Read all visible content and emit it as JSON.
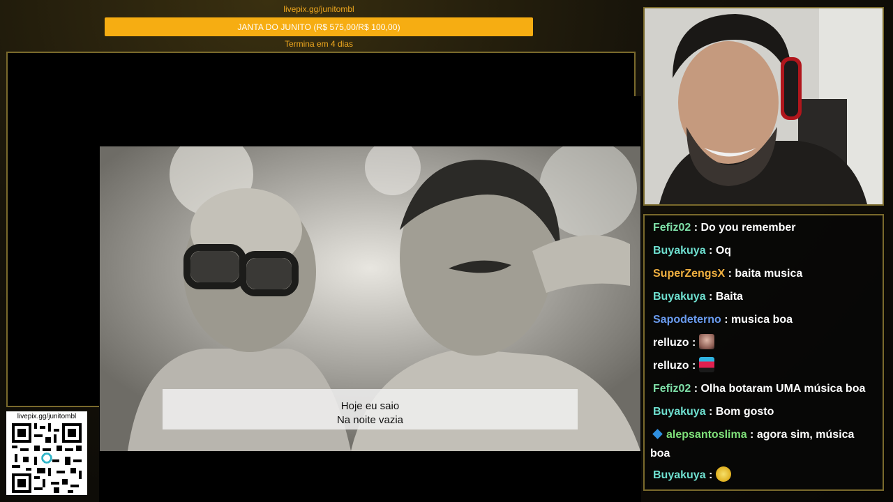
{
  "goal": {
    "url": "livepix.gg/junitombl",
    "label": "JANTA DO JUNITO (R$ 575,00/R$ 100,00)",
    "deadline": "Termina em 4 dias",
    "progress_percent": 100,
    "color": "#f6ad12"
  },
  "video": {
    "subtitle_line1": "Hoje eu saio",
    "subtitle_line2": "Na noite vazia"
  },
  "qr": {
    "url": "livepix.gg/junitombl"
  },
  "chat": {
    "messages": [
      {
        "user": "Fefiz02",
        "sep": " : ",
        "text": "Do you remember",
        "color": "#7fe0a8"
      },
      {
        "user": "Buyakuya",
        "sep": " : ",
        "text": "Oq",
        "color": "#6fe0d0"
      },
      {
        "user": "SuperZengsX",
        "sep": " : ",
        "text": "baita musica",
        "color": "#f0b040"
      },
      {
        "user": "Buyakuya",
        "sep": " : ",
        "text": "Baita",
        "color": "#6fe0d0"
      },
      {
        "user": "Sapodeterno",
        "sep": " : ",
        "text": "musica boa",
        "color": "#6a9cf0"
      },
      {
        "user": "relluzo",
        "sep": " : ",
        "text": "",
        "color": "#ffffff",
        "emote": "face-emote"
      },
      {
        "user": "relluzo",
        "sep": " : ",
        "text": "",
        "color": "#ffffff",
        "emote": "pixel-character-emote"
      },
      {
        "user": "Fefiz02",
        "sep": " : ",
        "text": "Olha botaram UMA música boa",
        "color": "#7fe0a8"
      },
      {
        "user": "Buyakuya",
        "sep": " : ",
        "text": "Bom gosto",
        "color": "#6fe0d0"
      },
      {
        "user": "alepsantoslima",
        "sep": " : ",
        "text": "agora sim, música",
        "text2": "boa",
        "color": "#7fe07a",
        "badge": "cube-badge-icon"
      },
      {
        "user": "Buyakuya",
        "sep": " : ",
        "text": "",
        "color": "#6fe0d0",
        "emote": "laughing-emote"
      }
    ]
  }
}
